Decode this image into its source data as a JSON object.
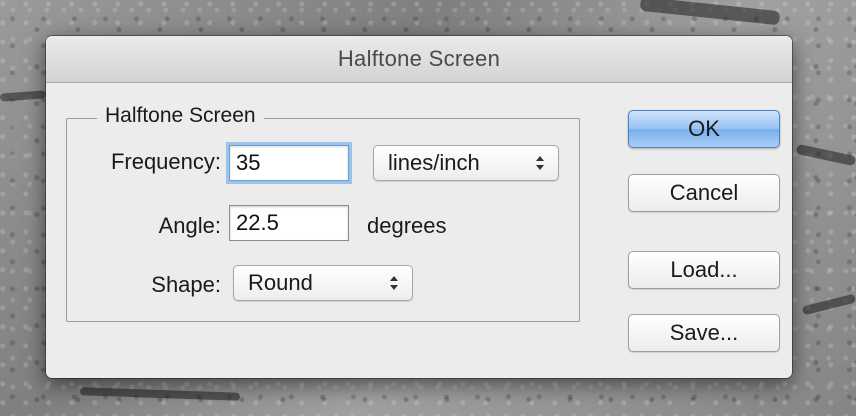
{
  "dialog": {
    "title": "Halftone Screen"
  },
  "group": {
    "legend": "Halftone Screen"
  },
  "fields": {
    "frequency": {
      "label": "Frequency:",
      "value": "35",
      "unit_selected": "lines/inch"
    },
    "angle": {
      "label": "Angle:",
      "value": "22.5",
      "unit": "degrees"
    },
    "shape": {
      "label": "Shape:",
      "selected": "Round"
    }
  },
  "buttons": {
    "ok": "OK",
    "cancel": "Cancel",
    "load": "Load...",
    "save": "Save..."
  },
  "colors": {
    "default_button": "#96c1f1",
    "focus_ring": "#9cc3ea",
    "dialog_bg": "#ececec"
  },
  "icons": {
    "popup_arrows": "up-down-chevron-icon"
  }
}
